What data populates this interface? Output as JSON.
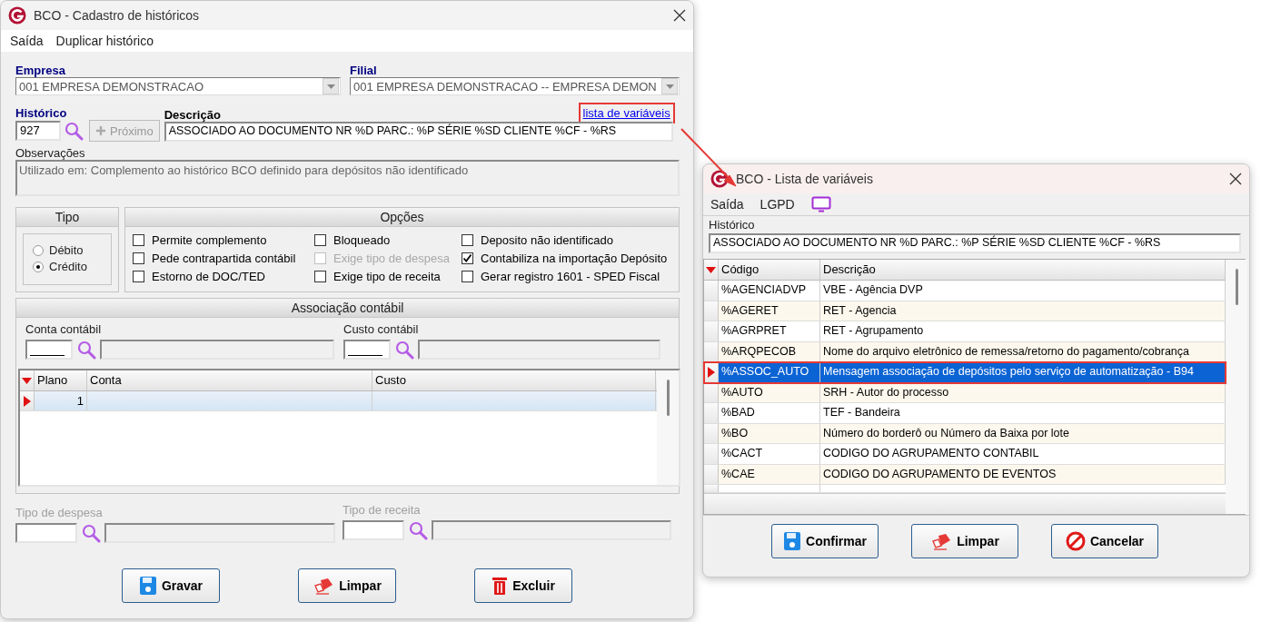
{
  "main_window": {
    "title": "BCO - Cadastro de históricos",
    "menu": [
      "Saída",
      "Duplicar histórico"
    ],
    "empresa": {
      "label": "Empresa",
      "value": "001 EMPRESA DEMONSTRACAO"
    },
    "filial": {
      "label": "Filial",
      "value": "001 EMPRESA DEMONSTRACAO -- EMPRESA DEMON"
    },
    "historico": {
      "label": "Histórico",
      "value": "927"
    },
    "proximo_button": {
      "label": "Próximo",
      "disabled": true
    },
    "descricao": {
      "label": "Descrição",
      "value": "ASSOCIADO AO DOCUMENTO NR %D PARC.: %P SÉRIE %SD CLIENTE %CF - %RS"
    },
    "variables_link": {
      "label": "lista de variáveis",
      "highlighted": true
    },
    "observacoes": {
      "label": "Observações",
      "value": "Utilizado em: Complemento ao histórico BCO definido para depósitos não identificado"
    },
    "tipo": {
      "title": "Tipo",
      "options": [
        {
          "label": "Débito",
          "selected": false
        },
        {
          "label": "Crédito",
          "selected": true
        }
      ]
    },
    "opcoes": {
      "title": "Opções",
      "items": [
        {
          "label": "Permite complemento",
          "checked": false,
          "disabled": false
        },
        {
          "label": "Pede contrapartida contábil",
          "checked": false,
          "disabled": false
        },
        {
          "label": "Estorno de DOC/TED",
          "checked": false,
          "disabled": false
        },
        {
          "label": "Bloqueado",
          "checked": false,
          "disabled": false
        },
        {
          "label": "Exige tipo de despesa",
          "checked": false,
          "disabled": true
        },
        {
          "label": "Exige tipo de receita",
          "checked": false,
          "disabled": false
        },
        {
          "label": "Deposito não identificado",
          "checked": false,
          "disabled": false
        },
        {
          "label": "Contabiliza na importação Depósito",
          "checked": true,
          "disabled": false
        },
        {
          "label": "Gerar registro 1601 - SPED Fiscal",
          "checked": false,
          "disabled": false
        }
      ]
    },
    "associacao": {
      "title": "Associação contábil",
      "conta_label": "Conta contábil",
      "custo_label": "Custo contábil",
      "columns": [
        "Plano",
        "Conta",
        "Custo"
      ],
      "rows": [
        {
          "plano": "1",
          "conta": "",
          "custo": "",
          "selected": true
        }
      ]
    },
    "tipo_despesa": {
      "label": "Tipo de despesa",
      "disabled": true
    },
    "tipo_receita": {
      "label": "Tipo de receita",
      "disabled": true
    },
    "buttons": [
      {
        "label": "Gravar",
        "kind": "save"
      },
      {
        "label": "Limpar",
        "kind": "clear"
      },
      {
        "label": "Excluir",
        "kind": "delete"
      }
    ]
  },
  "dialog": {
    "title": "BCO - Lista de variáveis",
    "menu": [
      "Saída",
      "LGPD"
    ],
    "historico": {
      "label": "Histórico",
      "value": "ASSOCIADO AO DOCUMENTO NR %D PARC.: %P SÉRIE %SD CLIENTE %CF - %RS"
    },
    "columns": [
      "Código",
      "Descrição"
    ],
    "rows": [
      {
        "codigo": "%AGENCIADVP",
        "descricao": "VBE - Agência DVP",
        "selected": false,
        "highlighted": false
      },
      {
        "codigo": "%AGERET",
        "descricao": "RET - Agencia",
        "selected": false,
        "highlighted": false
      },
      {
        "codigo": "%AGRPRET",
        "descricao": "RET - Agrupamento",
        "selected": false,
        "highlighted": false
      },
      {
        "codigo": "%ARQPECOB",
        "descricao": "Nome do arquivo eletrônico de remessa/retorno do pagamento/cobrança",
        "selected": false,
        "highlighted": false
      },
      {
        "codigo": "%ASSOC_AUTO",
        "descricao": "Mensagem associação de depósitos pelo serviço de automatização - B94",
        "selected": true,
        "highlighted": true
      },
      {
        "codigo": "%AUTO",
        "descricao": "SRH - Autor do processo",
        "selected": false,
        "highlighted": false
      },
      {
        "codigo": "%BAD",
        "descricao": "TEF - Bandeira",
        "selected": false,
        "highlighted": false
      },
      {
        "codigo": "%BO",
        "descricao": "Número do borderô ou Número da Baixa por lote",
        "selected": false,
        "highlighted": false
      },
      {
        "codigo": "%CACT",
        "descricao": "CODIGO DO AGRUPAMENTO CONTABIL",
        "selected": false,
        "highlighted": false
      },
      {
        "codigo": "%CAE",
        "descricao": "CODIGO DO AGRUPAMENTO DE EVENTOS",
        "selected": false,
        "highlighted": false
      }
    ],
    "buttons": [
      {
        "label": "Confirmar",
        "kind": "confirm"
      },
      {
        "label": "Limpar",
        "kind": "clear"
      },
      {
        "label": "Cancelar",
        "kind": "cancel"
      }
    ]
  }
}
